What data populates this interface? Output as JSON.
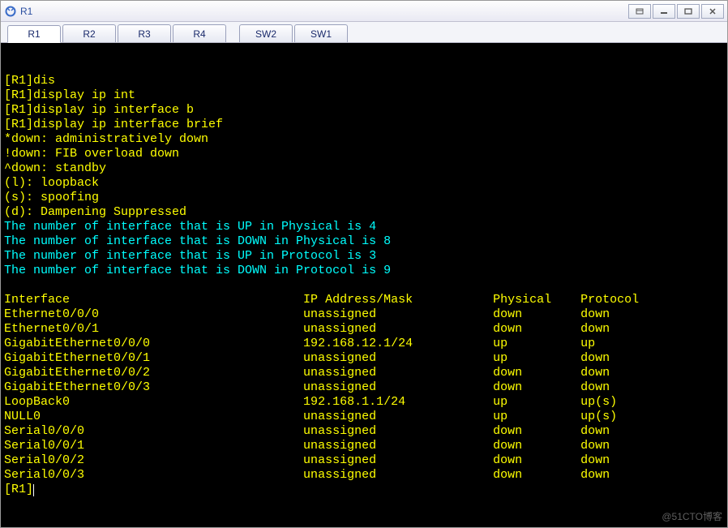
{
  "window": {
    "title": "R1"
  },
  "tabs": [
    {
      "label": "R1",
      "active": true
    },
    {
      "label": "R2",
      "active": false
    },
    {
      "label": "R3",
      "active": false
    },
    {
      "label": "R4",
      "active": false
    },
    {
      "label": "SW2",
      "active": false
    },
    {
      "label": "SW1",
      "active": false
    }
  ],
  "term": {
    "line0": "[R1]dis",
    "cmd1": "[R1]display ip int",
    "cmd2": "[R1]display ip interface b",
    "cmd3": "[R1]display ip interface brief",
    "note1": "*down: administratively down",
    "note2": "!down: FIB overload down",
    "note3": "^down: standby",
    "note4": "(l): loopback",
    "note5": "(s): spoofing",
    "note6": "(d): Dampening Suppressed",
    "phys_up": "The number of interface that is UP in Physical is 4",
    "phys_down": "The number of interface that is DOWN in Physical is 8",
    "prot_up": "The number of interface that is UP in Protocol is 3",
    "prot_down": "The number of interface that is DOWN in Protocol is 9",
    "hdr_if": "Interface",
    "hdr_ip": "IP Address/Mask",
    "hdr_phys": "Physical",
    "hdr_prot": "Protocol",
    "rows": [
      {
        "if": "Ethernet0/0/0",
        "ip": "unassigned",
        "phys": "down",
        "prot": "down"
      },
      {
        "if": "Ethernet0/0/1",
        "ip": "unassigned",
        "phys": "down",
        "prot": "down"
      },
      {
        "if": "GigabitEthernet0/0/0",
        "ip": "192.168.12.1/24",
        "phys": "up",
        "prot": "up"
      },
      {
        "if": "GigabitEthernet0/0/1",
        "ip": "unassigned",
        "phys": "up",
        "prot": "down"
      },
      {
        "if": "GigabitEthernet0/0/2",
        "ip": "unassigned",
        "phys": "down",
        "prot": "down"
      },
      {
        "if": "GigabitEthernet0/0/3",
        "ip": "unassigned",
        "phys": "down",
        "prot": "down"
      },
      {
        "if": "LoopBack0",
        "ip": "192.168.1.1/24",
        "phys": "up",
        "prot": "up(s)"
      },
      {
        "if": "NULL0",
        "ip": "unassigned",
        "phys": "up",
        "prot": "up(s)"
      },
      {
        "if": "Serial0/0/0",
        "ip": "unassigned",
        "phys": "down",
        "prot": "down"
      },
      {
        "if": "Serial0/0/1",
        "ip": "unassigned",
        "phys": "down",
        "prot": "down"
      },
      {
        "if": "Serial0/0/2",
        "ip": "unassigned",
        "phys": "down",
        "prot": "down"
      },
      {
        "if": "Serial0/0/3",
        "ip": "unassigned",
        "phys": "down",
        "prot": "down"
      }
    ],
    "prompt": "[R1]"
  },
  "watermark": "@51CTO博客"
}
